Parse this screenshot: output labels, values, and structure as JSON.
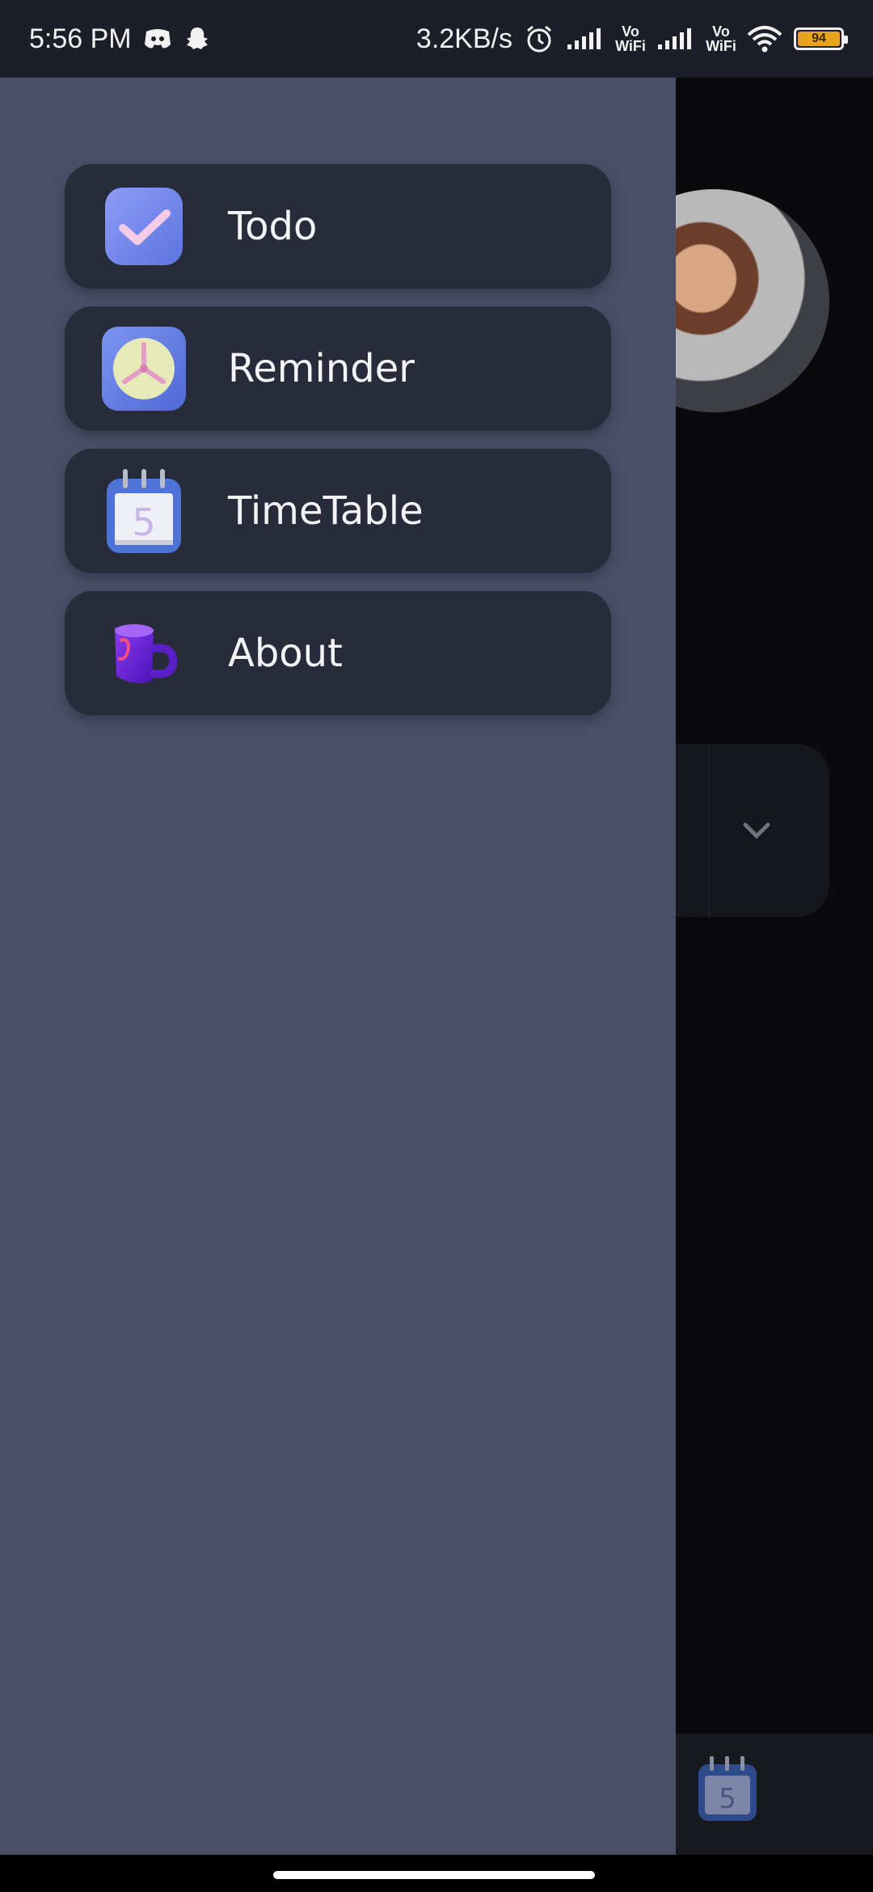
{
  "status_bar": {
    "time": "5:56 PM",
    "net_speed": "3.2KB/s",
    "vowifi_top": "Vo",
    "vowifi_bottom": "WiFi",
    "vowifi2_top": "Vo",
    "vowifi2_bottom": "WiFi",
    "battery_level": "94"
  },
  "drawer": {
    "items": [
      {
        "label": "Todo",
        "icon": "todo-check-icon"
      },
      {
        "label": "Reminder",
        "icon": "clock-icon"
      },
      {
        "label": "TimeTable",
        "icon": "calendar-icon"
      },
      {
        "label": "About",
        "icon": "mug-icon"
      }
    ]
  },
  "background": {
    "bottom_calendar_day": "5"
  },
  "colors": {
    "drawer_bg": "#4a4e67",
    "item_bg": "#272b3a",
    "status_bar_bg": "#1c1f28",
    "battery": "#e8a41c"
  }
}
